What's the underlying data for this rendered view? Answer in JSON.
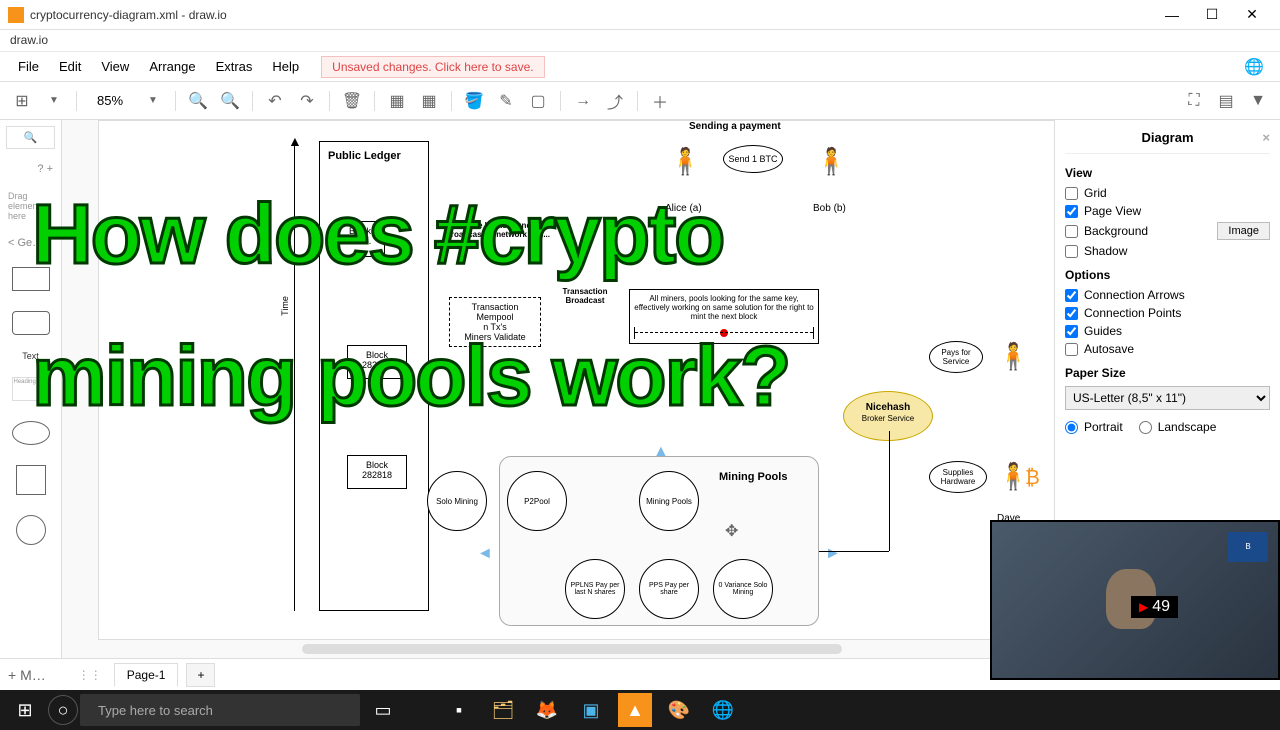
{
  "window": {
    "title": "cryptocurrency-diagram.xml - draw.io",
    "subtitle": "draw.io",
    "minimize": "—",
    "maximize": "☐",
    "close": "✕"
  },
  "menu": {
    "file": "File",
    "edit": "Edit",
    "view": "View",
    "arrange": "Arrange",
    "extras": "Extras",
    "help": "Help",
    "unsaved": "Unsaved changes. Click here to save."
  },
  "toolbar": {
    "zoom": "85%"
  },
  "shapes": {
    "search": "🔍",
    "addcat": "? +",
    "general": "< Ge…",
    "text_label": "Text",
    "more": "+ M…"
  },
  "diagram": {
    "public_ledger": "Public Ledger",
    "sending_payment": "Sending a payment",
    "send_btc": "Send 1 BTC",
    "alice": "Alice (a)",
    "bob": "Bob (b)",
    "time_axis": "Time",
    "block1": "Block 282819",
    "block2": "Block 282819",
    "block3": "Block 282818",
    "mempool": "Transaction Mempool",
    "mempool2": "n Tx's",
    "mempool3": "Miners Validate",
    "tx_broadcast": "Transaction Broadcast",
    "once_key": "Once key is found, broadcast to network and...",
    "miners_note": "All miners, pools looking for the same key, effectively working on same solution for the right to mint the next block",
    "solo_mining": "Solo Mining",
    "p2pool": "P2Pool",
    "mining_pools_circle": "Mining Pools",
    "mining_pools_label": "Mining Pools",
    "pplns": "PPLNS Pay per last N shares",
    "pps": "PPS Pay per share",
    "zerovar": "0 Variance Solo Mining",
    "nicehash": "Nicehash",
    "nicehash_sub": "Broker Service",
    "pays_for": "Pays for Service",
    "supplies_hw": "Supplies Hardware",
    "dave": "Dave"
  },
  "right": {
    "title": "Diagram",
    "view": "View",
    "grid": "Grid",
    "page_view": "Page View",
    "background": "Background",
    "image_btn": "Image",
    "shadow": "Shadow",
    "options": "Options",
    "conn_arrows": "Connection Arrows",
    "conn_points": "Connection Points",
    "guides": "Guides",
    "autosave": "Autosave",
    "paper_size": "Paper Size",
    "paper_sel": "US-Letter (8,5\" x 11\")",
    "portrait": "Portrait",
    "landscape": "Landscape"
  },
  "pages": {
    "add": "+ M…",
    "page1": "Page-1",
    "addtab": "+"
  },
  "taskbar": {
    "search_placeholder": "Type here to search"
  },
  "camera": {
    "count": "49"
  },
  "overlay": {
    "line1": "How does #crypto",
    "line2": "mining pools work?"
  }
}
